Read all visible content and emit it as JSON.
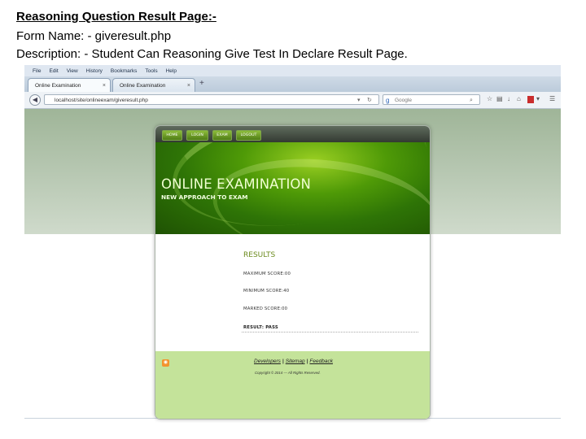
{
  "slide": {
    "title": "Reasoning Question Result Page:-",
    "form_name_line": "Form Name: - giveresult.php",
    "description_line": "Description: - Student Can Reasoning Give Test In Declare Result Page."
  },
  "browser": {
    "menu_items": [
      "File",
      "Edit",
      "View",
      "History",
      "Bookmarks",
      "Tools",
      "Help"
    ],
    "tabs": [
      {
        "label": "Online Examination",
        "close": "×"
      },
      {
        "label": "Online Examination",
        "close": "×"
      }
    ],
    "new_tab_symbol": "+",
    "url": "localhost/site/onlineexam/giveresult.php",
    "search_placeholder": "Google",
    "icons": [
      "back-arrow-icon",
      "dropdown-icon",
      "reload-icon",
      "search-engine-icon",
      "bookmark-star-icon",
      "download-icon",
      "home-icon",
      "addon-icon",
      "menu-icon"
    ]
  },
  "site": {
    "nav": [
      "HOME",
      "LOGIN",
      "EXAM",
      "LOGOUT"
    ],
    "title": "ONLINE EXAMINATION",
    "subtitle": "NEW APPROACH TO EXAM",
    "results": {
      "heading": "RESULTS",
      "maximum": "MAXIMUM SCORE:00",
      "minimum": "MINIMUM SCORE:40",
      "marked": "MARKED SCORE:00",
      "result": "RESULT: PASS"
    },
    "footer": {
      "links": [
        "Developers",
        "Sitemap",
        "Feedback"
      ],
      "separator": "|",
      "copyright": "Copyright © 2014 — All Rights Reserved."
    },
    "colors": {
      "accent_green": "#4f9a07",
      "footer_green": "#c4e39a",
      "results_heading": "#6c8b1e"
    }
  }
}
